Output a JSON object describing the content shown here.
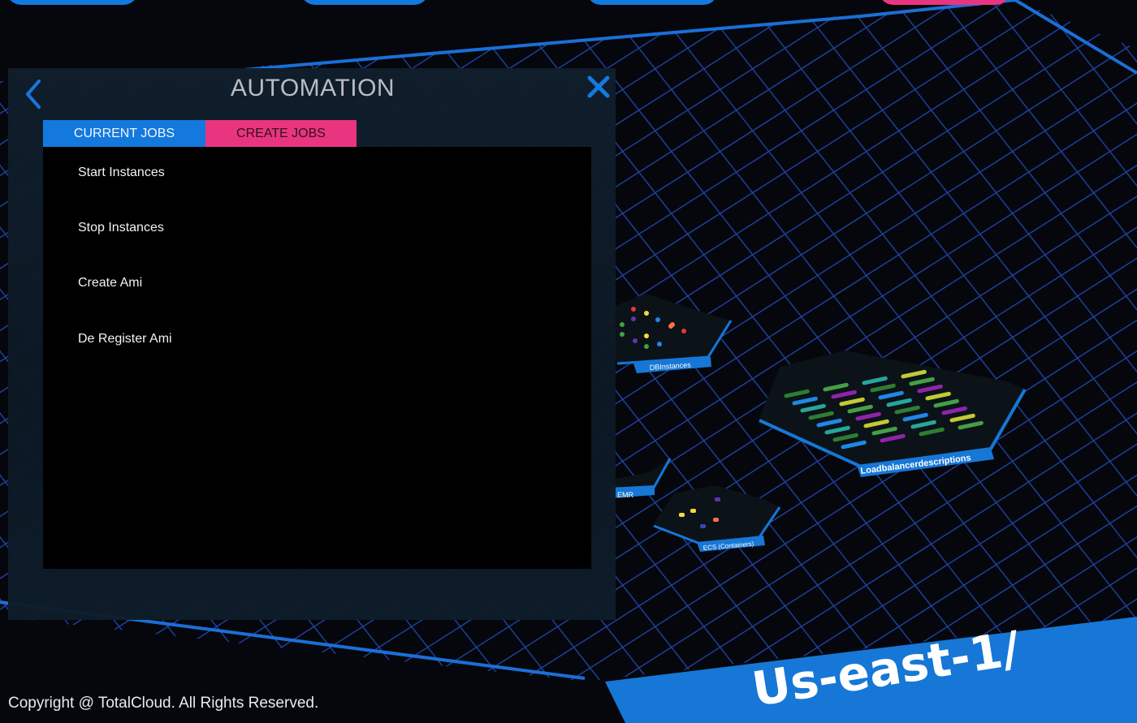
{
  "panel": {
    "title": "AUTOMATION",
    "tabs": [
      {
        "label": "CURRENT JOBS",
        "active": true
      },
      {
        "label": "CREATE JOBS",
        "active": false
      }
    ],
    "jobs": [
      {
        "label": "Start Instances"
      },
      {
        "label": "Stop Instances"
      },
      {
        "label": "Create Ami"
      },
      {
        "label": "De Register Ami"
      }
    ]
  },
  "scene": {
    "region_label": "Us-east-1/",
    "services": [
      {
        "label": "DBInstances"
      },
      {
        "label": "Loadbalancerdescriptions"
      },
      {
        "label": "EMR"
      },
      {
        "label": "ECS (Containers)"
      }
    ]
  },
  "footer": {
    "copyright": "Copyright @ TotalCloud. All Rights Reserved."
  },
  "colors": {
    "accent_blue": "#1479de",
    "accent_pink": "#e9357f",
    "grid_line": "#1f3f9a",
    "background": "#05070c"
  }
}
